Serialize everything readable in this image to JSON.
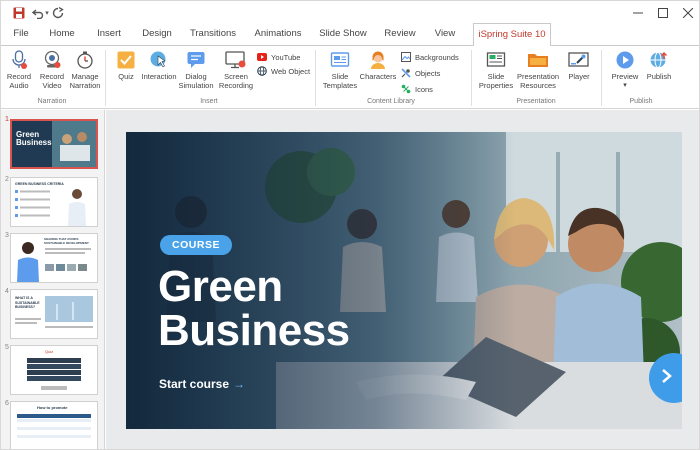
{
  "tabs": [
    "File",
    "Home",
    "Insert",
    "Design",
    "Transitions",
    "Animations",
    "Slide Show",
    "Review",
    "View",
    "iSpring Suite 10"
  ],
  "ribbon": {
    "narration": {
      "record_audio": "Record\nAudio",
      "record_video": "Record\nVideo",
      "manage_narration": "Manage\nNarration",
      "group": "Narration"
    },
    "insert": {
      "quiz": "Quiz",
      "interaction": "Interaction",
      "dialog_simulation": "Dialog\nSimulation",
      "screen_recording": "Screen\nRecording",
      "youtube": "YouTube",
      "web_object": "Web Object",
      "group": "Insert"
    },
    "content_library": {
      "slide_templates": "Slide\nTemplates",
      "characters": "Characters",
      "backgrounds": "Backgrounds",
      "objects": "Objects",
      "icons": "Icons",
      "group": "Content Library"
    },
    "presentation": {
      "slide_properties": "Slide\nProperties",
      "presentation_resources": "Presentation\nResources",
      "player": "Player",
      "group": "Presentation"
    },
    "publish": {
      "preview": "Preview",
      "publish": "Publish",
      "group": "Publish"
    }
  },
  "thumbnails": [
    {
      "num": "1",
      "title": "Green\nBusiness"
    },
    {
      "num": "2",
      "title": "GREEN BUSINESS CRITERIA"
    },
    {
      "num": "3",
      "title": "SHARING THAT AVOIDS SUSTAINABLE DEVELOPMENT"
    },
    {
      "num": "4",
      "title": "WHAT IS A SUSTAINABLE BUSINESS?"
    },
    {
      "num": "5",
      "title": "Quiz"
    },
    {
      "num": "6",
      "title": "How to promote"
    }
  ],
  "slide": {
    "badge": "COURSE",
    "title_line1": "Green",
    "title_line2": "Business",
    "start": "Start course",
    "start_arrow": "→"
  },
  "colors": {
    "accent": "#c0392b",
    "badge_blue": "#4aa3e8"
  }
}
